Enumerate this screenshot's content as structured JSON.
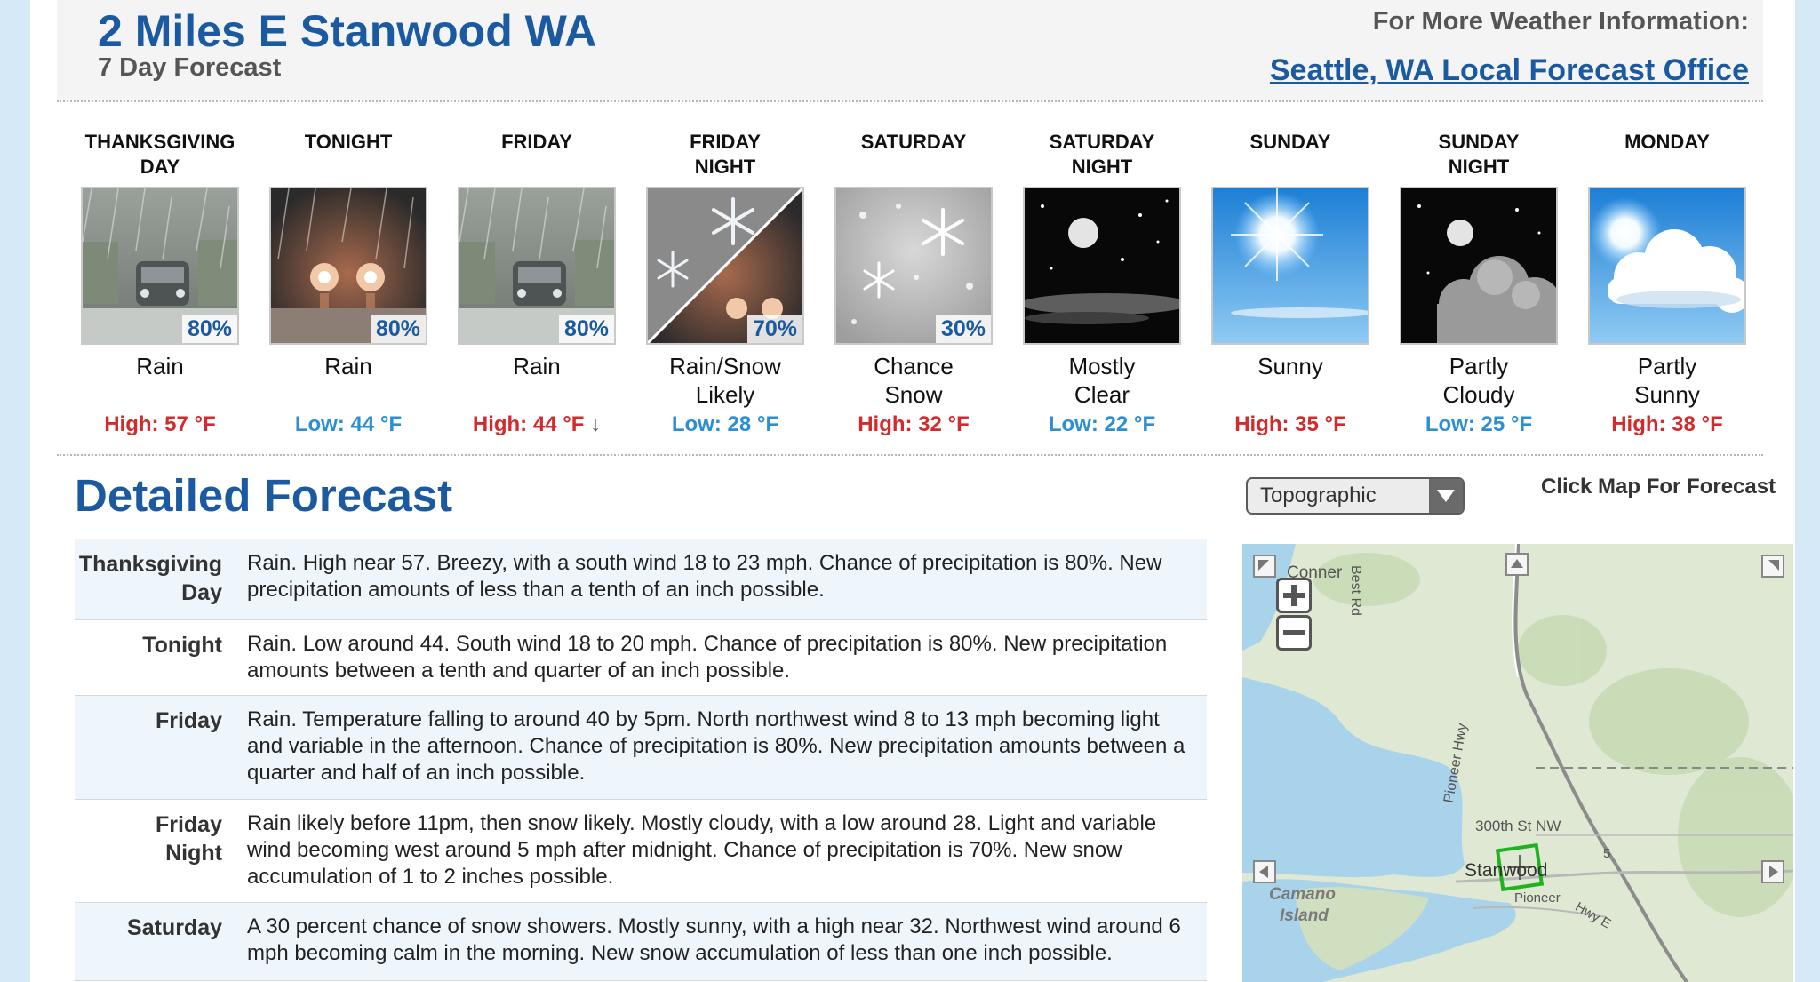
{
  "header": {
    "location": "2 Miles E Stanwood WA",
    "subtitle": "7 Day Forecast",
    "more_info": "For More Weather Information:",
    "office_link": "Seattle, WA Local Forecast Office"
  },
  "periods": [
    {
      "name_line1": "THANKSGIVING",
      "name_line2": "DAY",
      "icon": "rain-icon",
      "pop": "80%",
      "short1": "Rain",
      "short2": "",
      "temp": "High: 57 °F",
      "temp_type": "high"
    },
    {
      "name_line1": "TONIGHT",
      "name_line2": "",
      "icon": "rain-night-icon",
      "pop": "80%",
      "short1": "Rain",
      "short2": "",
      "temp": "Low: 44 °F",
      "temp_type": "low"
    },
    {
      "name_line1": "FRIDAY",
      "name_line2": "",
      "icon": "rain-icon",
      "pop": "80%",
      "short1": "Rain",
      "short2": "",
      "temp": "High: 44 °F",
      "temp_type": "high",
      "trend": "↓"
    },
    {
      "name_line1": "FRIDAY",
      "name_line2": "NIGHT",
      "icon": "rain-snow-icon",
      "pop": "70%",
      "short1": "Rain/Snow",
      "short2": "Likely",
      "temp": "Low: 28 °F",
      "temp_type": "low"
    },
    {
      "name_line1": "SATURDAY",
      "name_line2": "",
      "icon": "snow-icon",
      "pop": "30%",
      "short1": "Chance",
      "short2": "Snow",
      "temp": "High: 32 °F",
      "temp_type": "high"
    },
    {
      "name_line1": "SATURDAY",
      "name_line2": "NIGHT",
      "icon": "clear-night-icon",
      "pop": "",
      "short1": "Mostly",
      "short2": "Clear",
      "temp": "Low: 22 °F",
      "temp_type": "low"
    },
    {
      "name_line1": "SUNDAY",
      "name_line2": "",
      "icon": "sunny-icon",
      "pop": "",
      "short1": "Sunny",
      "short2": "",
      "temp": "High: 35 °F",
      "temp_type": "high"
    },
    {
      "name_line1": "SUNDAY",
      "name_line2": "NIGHT",
      "icon": "partly-cloudy-night-icon",
      "pop": "",
      "short1": "Partly",
      "short2": "Cloudy",
      "temp": "Low: 25 °F",
      "temp_type": "low"
    },
    {
      "name_line1": "MONDAY",
      "name_line2": "",
      "icon": "partly-sunny-icon",
      "pop": "",
      "short1": "Partly",
      "short2": "Sunny",
      "temp": "High: 38 °F",
      "temp_type": "high"
    }
  ],
  "detailed": {
    "title": "Detailed Forecast",
    "rows": [
      {
        "label1": "Thanksgiving",
        "label2": "Day",
        "text": "Rain. High near 57. Breezy, with a south wind 18 to 23 mph. Chance of precipitation is 80%. New precipitation amounts of less than a tenth of an inch possible."
      },
      {
        "label1": "Tonight",
        "label2": "",
        "text": "Rain. Low around 44. South wind 18 to 20 mph. Chance of precipitation is 80%. New precipitation amounts between a tenth and quarter of an inch possible."
      },
      {
        "label1": "Friday",
        "label2": "",
        "text": "Rain. Temperature falling to around 40 by 5pm. North northwest wind 8 to 13 mph becoming light and variable in the afternoon. Chance of precipitation is 80%. New precipitation amounts between a quarter and half of an inch possible."
      },
      {
        "label1": "Friday",
        "label2": "Night",
        "text": "Rain likely before 11pm, then snow likely. Mostly cloudy, with a low around 28. Light and variable wind becoming west around 5 mph after midnight. Chance of precipitation is 70%. New snow accumulation of 1 to 2 inches possible."
      },
      {
        "label1": "Saturday",
        "label2": "",
        "text": "A 30 percent chance of snow showers. Mostly sunny, with a high near 32. Northwest wind around 6 mph becoming calm in the morning. New snow accumulation of less than one inch possible."
      }
    ]
  },
  "map": {
    "layer_select": "Topographic",
    "hint": "Click Map For Forecast",
    "labels": {
      "conner": "Conner",
      "best_rd": "Best Rd",
      "pioneer_hwy": "Pioneer Hwy",
      "st_300": "300th St NW",
      "stanwood": "Stanwood",
      "camano": "Camano",
      "island": "Island",
      "pioneer2": "Pioneer",
      "hwy_e": "Hwy E",
      "route": "5"
    }
  }
}
